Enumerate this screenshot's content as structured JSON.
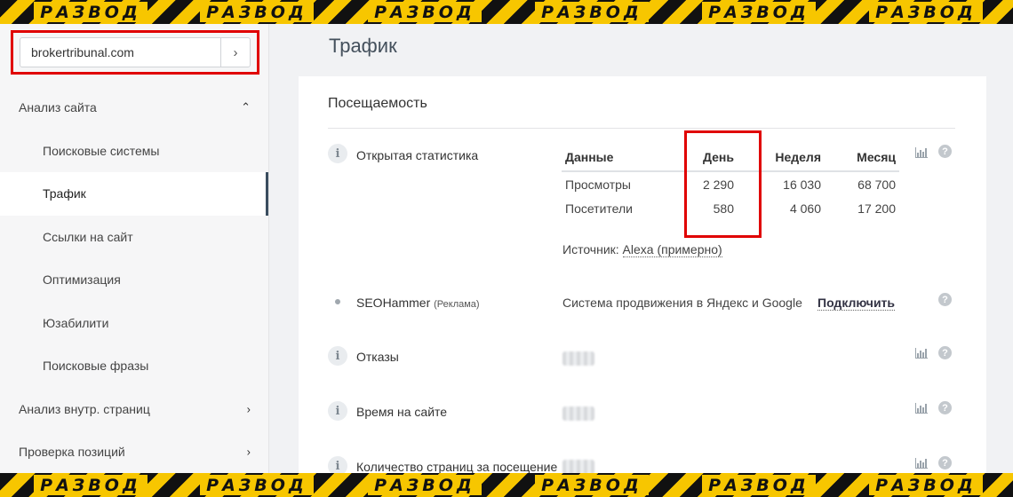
{
  "banner": {
    "text": "РАЗВОД"
  },
  "sidebar": {
    "domain_value": "brokertribunal.com",
    "go_icon": "›",
    "items": [
      {
        "label": "Анализ сайта",
        "chevron": "⌃"
      },
      {
        "label": "Поисковые системы"
      },
      {
        "label": "Трафик"
      },
      {
        "label": "Ссылки на сайт"
      },
      {
        "label": "Оптимизация"
      },
      {
        "label": "Юзабилити"
      },
      {
        "label": "Поисковые фразы"
      },
      {
        "label": "Анализ внутр. страниц",
        "chevron": "›"
      },
      {
        "label": "Проверка позиций",
        "chevron": "›"
      }
    ]
  },
  "main": {
    "page_title": "Трафик",
    "card_title": "Посещаемость",
    "rows": {
      "open_stats": {
        "icon": "i",
        "label": "Открытая статистика"
      },
      "seo": {
        "label": "SEOHammer",
        "tag": "(Реклама)",
        "description": "Система продвижения в Яндекс и Google",
        "link": "Подключить"
      },
      "bounce": {
        "icon": "i",
        "label": "Отказы"
      },
      "time": {
        "icon": "i",
        "label": "Время на сайте"
      },
      "pages": {
        "icon": "i",
        "label": "Количество страниц за посещение"
      }
    },
    "table": {
      "headers": [
        "Данные",
        "День",
        "Неделя",
        "Месяц"
      ],
      "rows": [
        [
          "Просмотры",
          "2 290",
          "16 030",
          "68 700"
        ],
        [
          "Посетители",
          "580",
          "4 060",
          "17 200"
        ]
      ]
    },
    "source": {
      "label": "Источник:",
      "link": "Alexa (примерно)"
    },
    "help_icon": "?"
  },
  "colors": {
    "highlight": "#e00000",
    "tape_yellow": "#f7c600",
    "tape_black": "#111111"
  }
}
